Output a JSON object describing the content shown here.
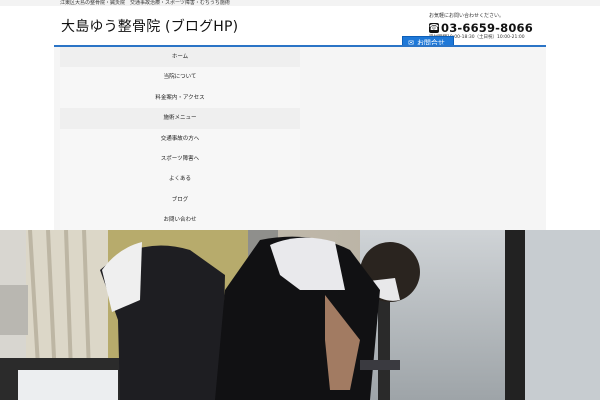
{
  "header": {
    "tagline": "江東区大島の整骨院・鍼灸院　交通事故治療・スポーツ障害・むちうち施術",
    "site_title": "大島ゆう整骨院 (ブログHP)",
    "contact_caption": "お気軽にお問い合わせください。",
    "phone": "03-6659-8066",
    "hours": "受付時間10:00-18:30（土日祝）10:00-21:00",
    "mail_label": "お問合せ"
  },
  "nav": {
    "items": [
      {
        "label": "ホーム"
      },
      {
        "label": "当院について"
      },
      {
        "label": "料金案内・アクセス"
      },
      {
        "label": "施術メニュー"
      },
      {
        "label": "交通事故の方へ"
      },
      {
        "label": "スポーツ障害へ"
      },
      {
        "label": "よくある"
      },
      {
        "label": "ブログ"
      },
      {
        "label": "お問い合わせ"
      }
    ]
  },
  "icons": {
    "phone": "phone-icon",
    "mail": "mail-icon"
  },
  "colors": {
    "accent": "#2b74c6",
    "button": "#1e78d8"
  }
}
